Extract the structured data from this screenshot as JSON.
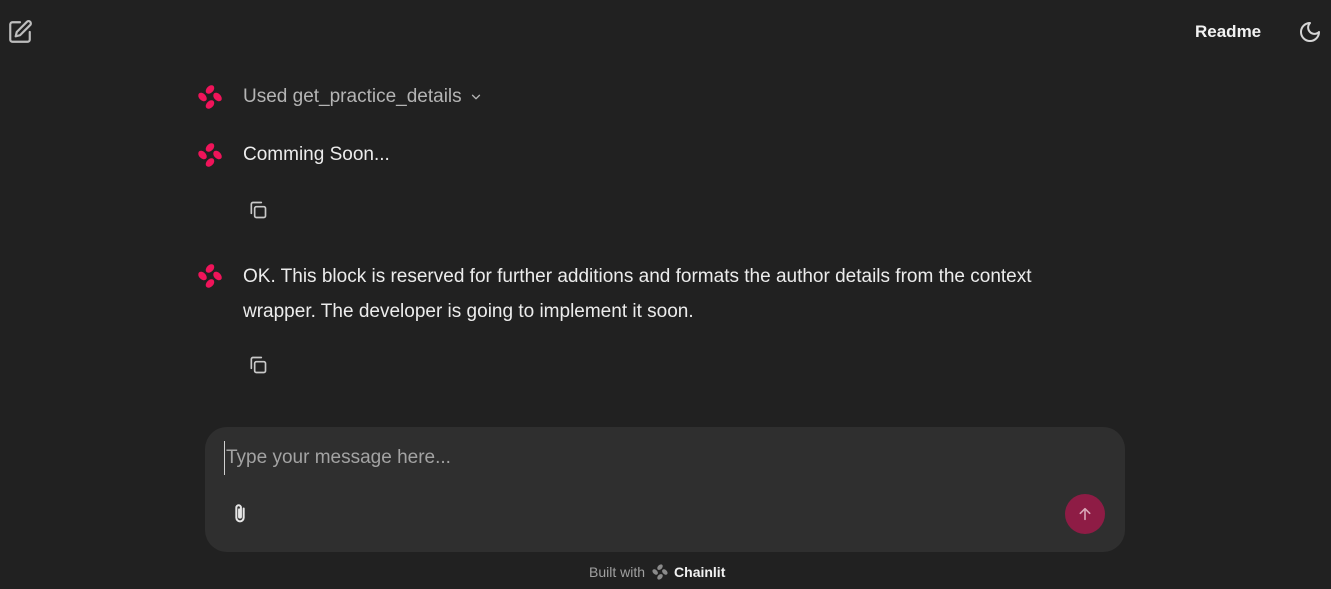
{
  "header": {
    "readme_label": "Readme",
    "new_chat_icon": "edit-square-icon",
    "theme_icon": "moon-icon"
  },
  "messages": [
    {
      "type": "step",
      "label": "Used get_practice_details",
      "icon": "chevron-down-icon"
    },
    {
      "type": "text",
      "text": "Comming Soon..."
    },
    {
      "type": "text",
      "text": "OK. This block is reserved for further additions and formats the author details from the context wrapper. The developer is going to implement it soon."
    }
  ],
  "composer": {
    "placeholder": "Type your message here...",
    "value": "",
    "attach_icon": "paperclip-icon",
    "send_icon": "arrow-up-icon"
  },
  "footer": {
    "built_with": "Built with",
    "brand": "Chainlit"
  },
  "colors": {
    "background": "#212121",
    "composer_bg": "#2f2f2f",
    "accent": "#f0145a",
    "send_button": "#8e1c45"
  }
}
